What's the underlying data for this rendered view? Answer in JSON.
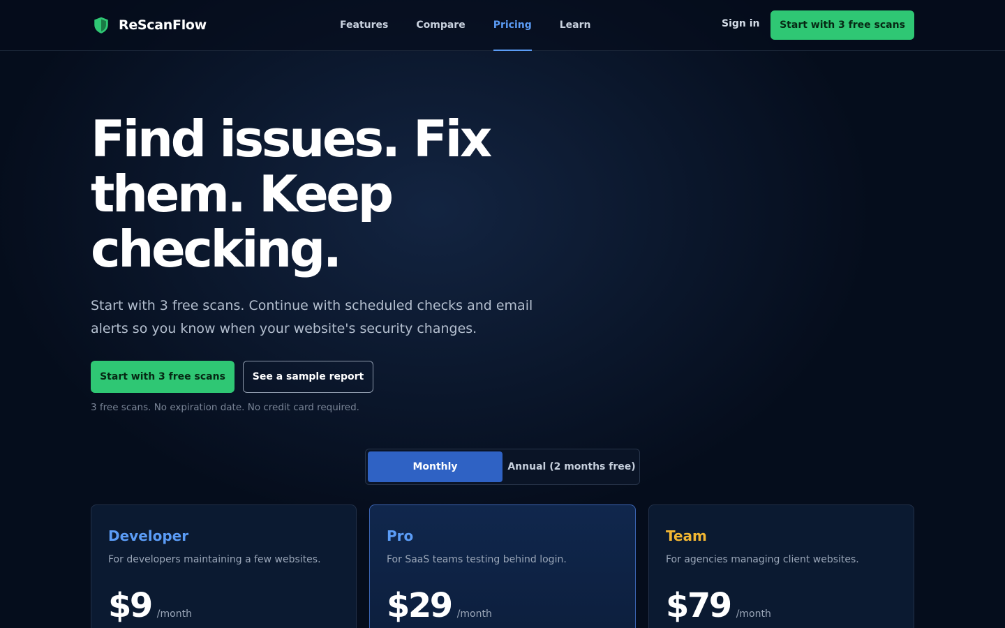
{
  "brand": {
    "name": "ReScanFlow",
    "icon": "shield-check-icon",
    "icon_color": "#2fc774"
  },
  "nav": {
    "links": [
      {
        "label": "Features",
        "active": false
      },
      {
        "label": "Compare",
        "active": false
      },
      {
        "label": "Pricing",
        "active": true
      },
      {
        "label": "Learn",
        "active": false
      }
    ],
    "sign_in": "Sign in",
    "cta": "Start with 3 free scans"
  },
  "hero": {
    "title": "Find issues. Fix them. Keep checking.",
    "subtitle": "Start with 3 free scans. Continue with scheduled checks and email alerts so you know when your website's security changes.",
    "primary_cta": "Start with 3 free scans",
    "secondary_cta": "See a sample report",
    "fineprint": "3 free scans. No expiration date. No credit card required."
  },
  "billing_toggle": {
    "options": [
      "Monthly",
      "Annual (2 months free)"
    ],
    "selected": "Monthly"
  },
  "plans": [
    {
      "name": "Developer",
      "description": "For developers maintaining a few websites.",
      "price": "$9",
      "period": "/month",
      "accent": "#5b9cf6"
    },
    {
      "name": "Pro",
      "description": "For SaaS teams testing behind login.",
      "price": "$29",
      "period": "/month",
      "accent": "#5b9cf6"
    },
    {
      "name": "Team",
      "description": "For agencies managing client websites.",
      "price": "$79",
      "period": "/month",
      "accent": "#f2b632"
    }
  ],
  "colors": {
    "accent_green": "#2fc774",
    "accent_blue": "#5b9cf6",
    "background": "#050d1c"
  }
}
